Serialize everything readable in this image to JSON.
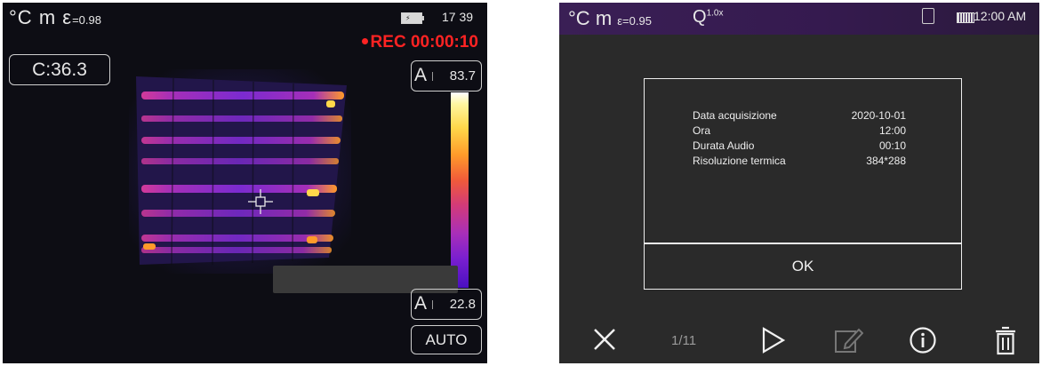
{
  "left_screen": {
    "unit_celsius": "°C",
    "mode_letter": "m",
    "epsilon_symbol": "ε",
    "emissivity": "=0.98",
    "clock": "17 39",
    "rec_label": "REC 00:00:10",
    "center_temp": "C:36.3",
    "max_label": "A",
    "max_temp": "83.7",
    "min_label": "A",
    "min_temp": "22.8",
    "auto_label": "AUTO",
    "colors": {
      "rec": "#ff2323",
      "background": "#0d0d14"
    }
  },
  "right_screen": {
    "unit_celsius": "°C",
    "mode_letter": "m",
    "emissivity": "ε=0.95",
    "zoom_symbol": "Q",
    "zoom": "1.0x",
    "clock": "12:00 AM",
    "dialog": {
      "rows": [
        {
          "label": "Data acquisizione",
          "value": "2020-10-01"
        },
        {
          "label": "Ora",
          "value": "12:00"
        },
        {
          "label": "Durata Audio",
          "value": "00:10"
        },
        {
          "label": "Risoluzione termica",
          "value": "384*288"
        }
      ],
      "ok_label": "OK"
    },
    "page_counter": "1/11",
    "icons": [
      "close-icon",
      "play-icon",
      "edit-icon",
      "info-icon",
      "trash-icon"
    ],
    "colors": {
      "topbar": "#3a1f55",
      "background": "#2a2a2a"
    }
  }
}
